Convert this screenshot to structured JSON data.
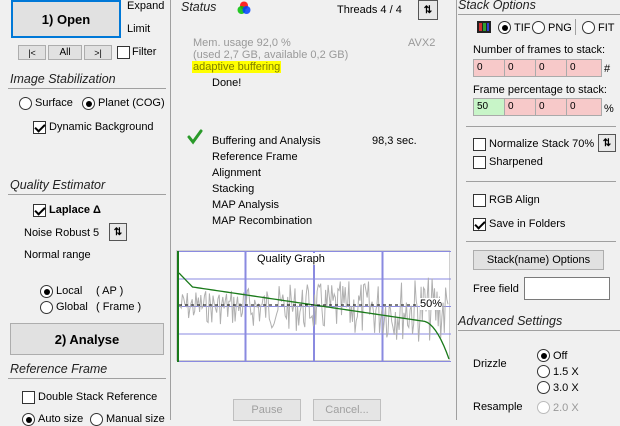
{
  "left": {
    "open_button": "1) Open",
    "expand_label": "Expand",
    "limit_label": "Limit",
    "nav_prev": "|<",
    "nav_all": "All",
    "nav_next": ">|",
    "filter_label": "Filter",
    "image_stabilization": {
      "title": "Image Stabilization",
      "surface_label": "Surface",
      "planet_label": "Planet (COG)",
      "selected": "planet",
      "dynamic_background_label": "Dynamic Background",
      "dynamic_background_checked": true
    },
    "quality_estimator": {
      "title": "Quality Estimator",
      "laplace_label": "Laplace Δ",
      "laplace_checked": true,
      "noise_robust_label": "Noise Robust",
      "noise_robust_value": "5",
      "normal_range_label": "Normal range",
      "local_label": "Local",
      "local_ap": "( AP )",
      "global_label": "Global",
      "global_frame": "( Frame )",
      "selected": "local"
    },
    "analyse_button": "2) Analyse",
    "reference_frame": {
      "title": "Reference Frame",
      "double_stack_label": "Double Stack Reference",
      "double_stack_checked": false,
      "auto_size_label": "Auto size",
      "manual_size_label": "Manual size",
      "selected": "auto"
    }
  },
  "status": {
    "title": "Status",
    "threads_label": "Threads 4 / 4",
    "mem_usage": "Mem. usage 92,0 %",
    "mem_detail": "(used 2,7 GB, available 0,2 GB)",
    "avx_label": "AVX2",
    "adaptive_buffering": "adaptive buffering",
    "done_label": "Done!",
    "steps": [
      {
        "label": "Buffering and Analysis",
        "time": "98,3 sec.",
        "done": true
      },
      {
        "label": "Reference Frame",
        "time": "",
        "done": false
      },
      {
        "label": "Alignment",
        "time": "",
        "done": false
      },
      {
        "label": "Stacking",
        "time": "",
        "done": false
      },
      {
        "label": "MAP Analysis",
        "time": "",
        "done": false
      },
      {
        "label": "MAP Recombination",
        "time": "",
        "done": false
      }
    ],
    "pause_button": "Pause",
    "cancel_button": "Cancel..."
  },
  "chart_data": {
    "type": "line",
    "title": "Quality Graph",
    "marker_label": "50%",
    "series": [
      {
        "name": "",
        "description": "sorted quality, descending",
        "color": "#1a7a1a"
      },
      {
        "name": "",
        "description": "per-frame quality",
        "color": "#b0b0b0"
      }
    ],
    "ylim": [
      0,
      1
    ]
  },
  "stack_options": {
    "title": "Stack Options",
    "format_tif": "TIF",
    "format_png": "PNG",
    "format_fit": "FIT",
    "format_selected": "tif",
    "frames_label": "Number of frames to stack:",
    "frames_values": [
      "0",
      "0",
      "0",
      "0"
    ],
    "frames_suffix": "#",
    "percent_label": "Frame percentage to stack:",
    "percent_values": [
      "50",
      "0",
      "0",
      "0"
    ],
    "percent_suffix": "%",
    "normalize_label": "Normalize Stack 70%",
    "normalize_checked": false,
    "sharpened_label": "Sharpened",
    "sharpened_checked": false,
    "rgb_align_label": "RGB Align",
    "rgb_align_checked": false,
    "save_folders_label": "Save in Folders",
    "save_folders_checked": true,
    "stack_name_button": "Stack(name) Options",
    "free_field_label": "Free field",
    "free_field_value": ""
  },
  "advanced": {
    "title": "Advanced Settings",
    "drizzle_label": "Drizzle",
    "drizzle_off": "Off",
    "drizzle_15": "1.5 X",
    "drizzle_30": "3.0 X",
    "drizzle_selected": "off",
    "resample_label": "Resample",
    "resample_20": "2.0 X"
  },
  "colors": {
    "quality_curve": "#1a7a1a",
    "raw_quality": "#b0b0b0",
    "graph_grid": "#8a8ae0",
    "adaptive_highlight": "#ffff00",
    "frame_box_red": "#f7c9c9",
    "frame_box_green": "#c8f5c8"
  }
}
